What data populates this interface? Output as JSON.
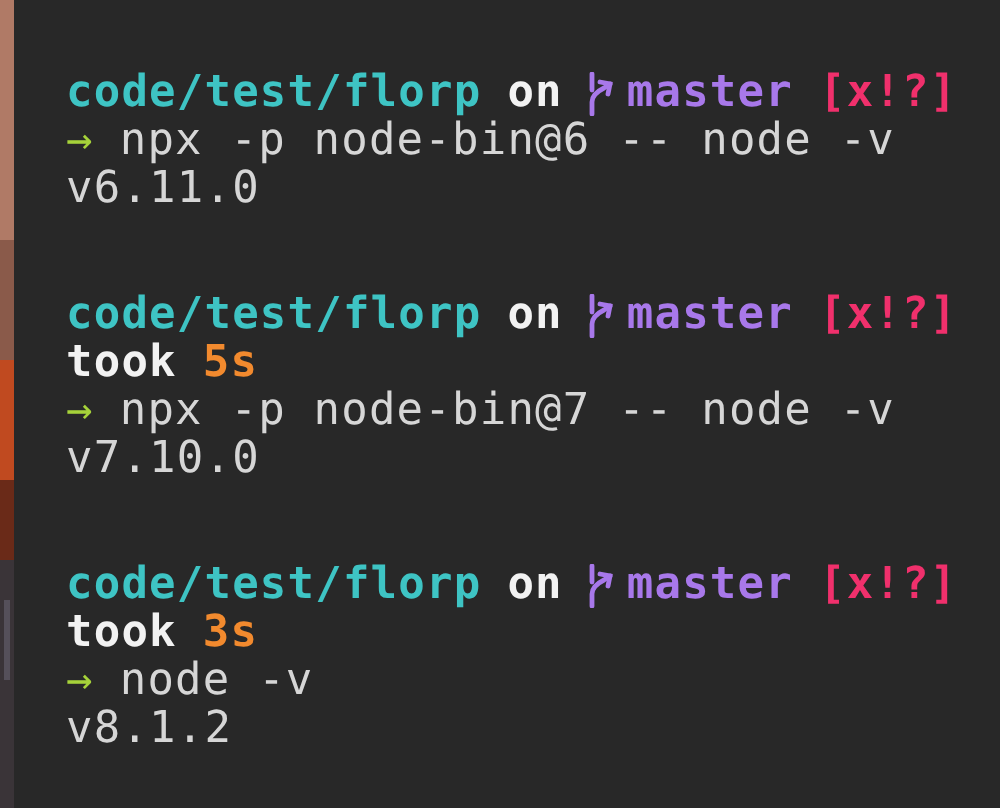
{
  "blocks": [
    {
      "prompt": {
        "path": "code/test/florp",
        "joiner": "on",
        "branch": "master",
        "status": "[x!?]"
      },
      "arrow": "→",
      "command": "npx -p node-bin@6 -- node -v",
      "output": "v6.11.0"
    },
    {
      "prompt": {
        "path": "code/test/florp",
        "joiner": "on",
        "branch": "master",
        "status": "[x!?]"
      },
      "took": {
        "label": "took",
        "duration": "5s"
      },
      "arrow": "→",
      "command": "npx -p node-bin@7 -- node -v",
      "output": "v7.10.0"
    },
    {
      "prompt": {
        "path": "code/test/florp",
        "joiner": "on",
        "branch": "master",
        "status": "[x!?]"
      },
      "took": {
        "label": "took",
        "duration": "3s"
      },
      "arrow": "→",
      "command": "node -v",
      "output": "v8.1.2"
    }
  ]
}
